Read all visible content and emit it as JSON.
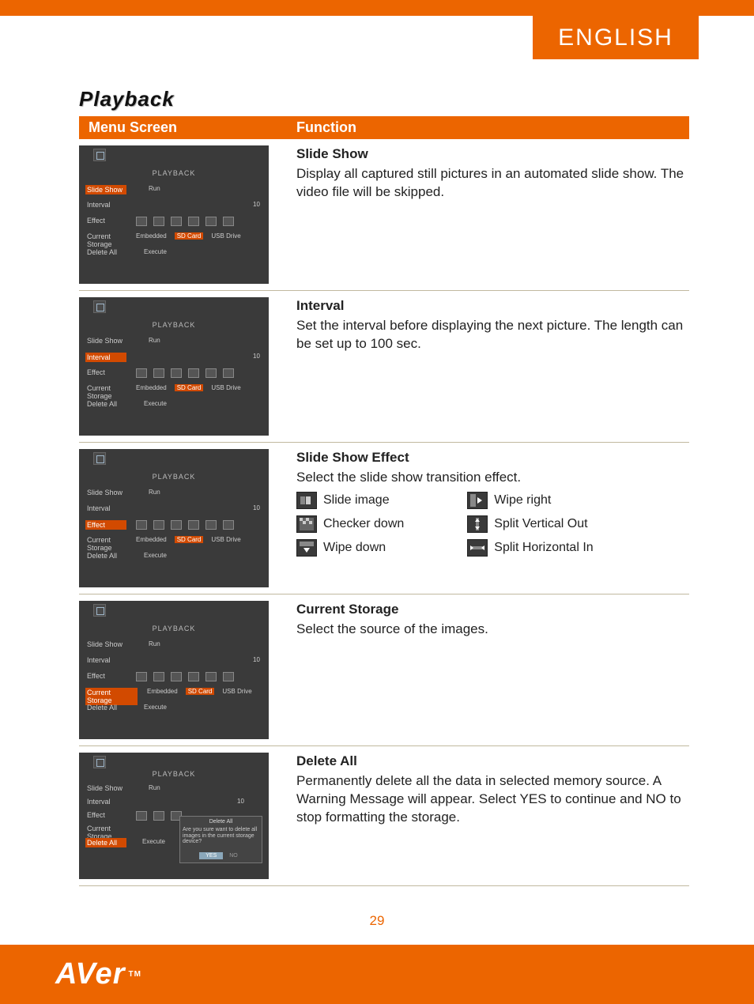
{
  "language_tab": "ENGLISH",
  "section_title": "Playback",
  "header": {
    "menu": "Menu Screen",
    "function": "Function"
  },
  "page_number": "29",
  "logo_text": "AVer",
  "logo_tm": "TM",
  "menushot": {
    "playback_label": "PLAYBACK",
    "rows": {
      "slide_show": "Slide Show",
      "interval": "Interval",
      "effect": "Effect",
      "current_storage": "Current Storage",
      "delete_all": "Delete All"
    },
    "run": "Run",
    "interval_value": "10",
    "execute": "Execute",
    "storage_opts": {
      "embedded": "Embedded",
      "sdcard": "SD Card",
      "usb": "USB Drive"
    },
    "dialog": {
      "title": "Delete All",
      "body": "Are you sure want to delete all images in the current storage device?",
      "yes": "YES",
      "no": "NO"
    }
  },
  "functions": {
    "slide_show": {
      "title": "Slide Show",
      "body": "Display all captured still pictures in an automated slide show. The video file will be skipped."
    },
    "interval": {
      "title": "Interval",
      "body": "Set the interval before displaying the next picture. The length can be set up to 100 sec."
    },
    "effect": {
      "title": "Slide Show Effect",
      "body": "Select the slide show transition effect.",
      "items": {
        "slide_image": "Slide image",
        "checker_down": "Checker down",
        "wipe_down": "Wipe down",
        "wipe_right": "Wipe right",
        "split_vout": "Split Vertical Out",
        "split_hin": "Split Horizontal In"
      }
    },
    "current_storage": {
      "title": "Current Storage",
      "body": "Select the source of the images."
    },
    "delete_all": {
      "title": "Delete All",
      "body": "Permanently delete all the data in selected memory source. A Warning Message will appear. Select YES to continue and NO to stop formatting the storage."
    }
  }
}
